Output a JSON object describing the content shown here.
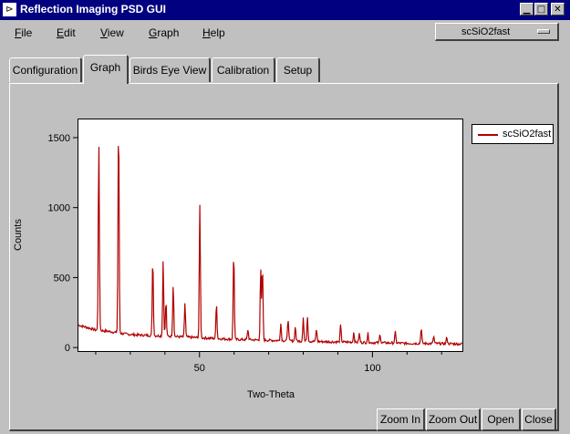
{
  "window": {
    "title": "Reflection Imaging PSD GUI",
    "icon": "app-logo-icon"
  },
  "menu": [
    {
      "underline": "F",
      "rest": "ile"
    },
    {
      "underline": "E",
      "rest": "dit"
    },
    {
      "underline": "V",
      "rest": "iew"
    },
    {
      "underline": "G",
      "rest": "raph"
    },
    {
      "underline": "H",
      "rest": "elp"
    }
  ],
  "dataset_select": {
    "value": "scSiO2fast"
  },
  "tabs": [
    {
      "label": "Configuration",
      "active": false
    },
    {
      "label": "Graph",
      "active": true
    },
    {
      "label": "Birds Eye View",
      "active": false
    },
    {
      "label": "Calibration",
      "active": false
    },
    {
      "label": "Setup",
      "active": false
    }
  ],
  "buttons": {
    "zoom_in": "Zoom In",
    "zoom_out": "Zoom Out",
    "open": "Open",
    "close": "Close"
  },
  "chart_data": {
    "type": "line",
    "xlabel": "Two-Theta",
    "ylabel": "Counts",
    "xlim": [
      15,
      126
    ],
    "ylim": [
      -25,
      1630
    ],
    "xticks": [
      50,
      100
    ],
    "yticks": [
      0,
      500,
      1000,
      1500
    ],
    "grid": false,
    "legend_position": "right",
    "series": [
      {
        "name": "scSiO2fast",
        "color": "#b00000",
        "baseline": [
          [
            15,
            160
          ],
          [
            18,
            140
          ],
          [
            20,
            125
          ],
          [
            24,
            115
          ],
          [
            28,
            98
          ],
          [
            32,
            90
          ],
          [
            40,
            82
          ],
          [
            50,
            70
          ],
          [
            60,
            58
          ],
          [
            70,
            52
          ],
          [
            80,
            45
          ],
          [
            90,
            40
          ],
          [
            100,
            35
          ],
          [
            110,
            30
          ],
          [
            120,
            28
          ],
          [
            126,
            25
          ]
        ],
        "peaks": [
          {
            "x": 20.9,
            "y": 1470
          },
          {
            "x": 26.6,
            "y": 1630
          },
          {
            "x": 36.5,
            "y": 640
          },
          {
            "x": 39.5,
            "y": 620
          },
          {
            "x": 40.3,
            "y": 330
          },
          {
            "x": 42.4,
            "y": 450
          },
          {
            "x": 45.8,
            "y": 320
          },
          {
            "x": 50.1,
            "y": 1010
          },
          {
            "x": 54.9,
            "y": 320
          },
          {
            "x": 59.9,
            "y": 690
          },
          {
            "x": 64.0,
            "y": 130
          },
          {
            "x": 67.7,
            "y": 560
          },
          {
            "x": 68.2,
            "y": 580
          },
          {
            "x": 73.5,
            "y": 170
          },
          {
            "x": 75.6,
            "y": 210
          },
          {
            "x": 77.7,
            "y": 150
          },
          {
            "x": 80.0,
            "y": 220
          },
          {
            "x": 81.2,
            "y": 230
          },
          {
            "x": 83.8,
            "y": 130
          },
          {
            "x": 90.8,
            "y": 160
          },
          {
            "x": 94.6,
            "y": 110
          },
          {
            "x": 96.2,
            "y": 100
          },
          {
            "x": 98.7,
            "y": 100
          },
          {
            "x": 102.2,
            "y": 95
          },
          {
            "x": 106.6,
            "y": 110
          },
          {
            "x": 114.1,
            "y": 140
          },
          {
            "x": 117.7,
            "y": 80
          },
          {
            "x": 121.5,
            "y": 75
          }
        ]
      }
    ]
  }
}
